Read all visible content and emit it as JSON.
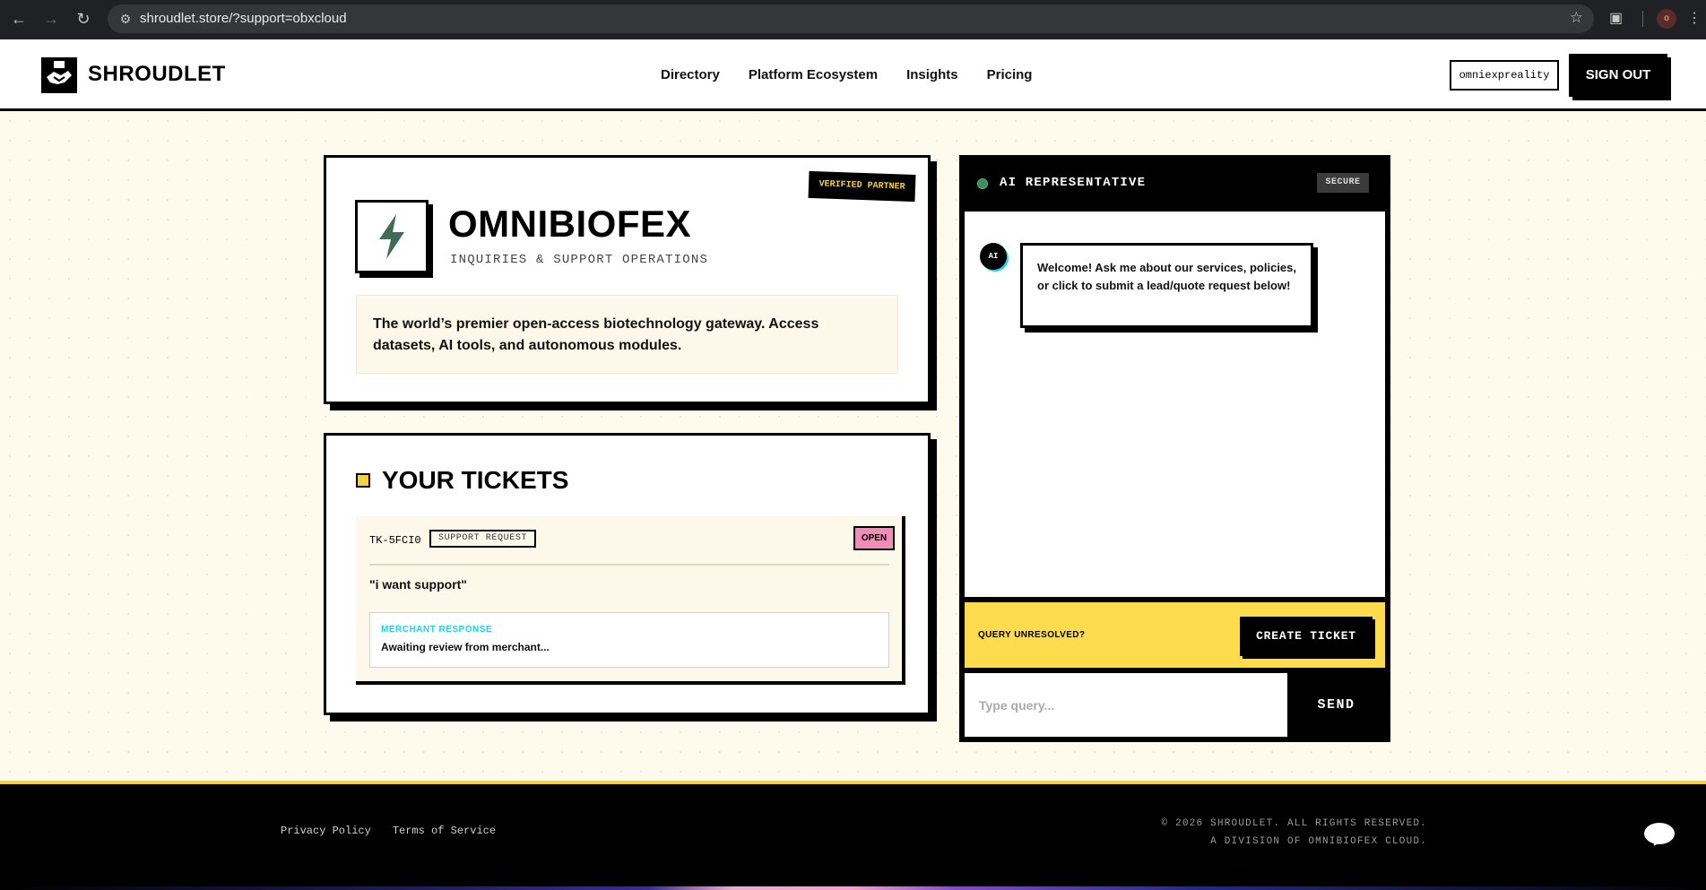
{
  "browser": {
    "url": "shroudlet.store/?support=obxcloud",
    "profile_initial": "o"
  },
  "header": {
    "logo_text": "SHROUDLET",
    "nav": [
      "Directory",
      "Platform Ecosystem",
      "Insights",
      "Pricing"
    ],
    "username": "omniexpreality",
    "signout_label": "SIGN OUT"
  },
  "company": {
    "badge": "VERIFIED PARTNER",
    "name": "OMNIBIOFEX",
    "subtitle": "INQUIRIES & SUPPORT OPERATIONS",
    "description": "The world’s premier open-access biotechnology gateway. Access datasets, AI tools, and autonomous modules.",
    "icon": "lightning-bolt-icon"
  },
  "tickets": {
    "title": "YOUR TICKETS",
    "items": [
      {
        "id": "TK-5FCI0",
        "type": "SUPPORT REQUEST",
        "status": "OPEN",
        "message": "\"i want support\"",
        "response_label": "MERCHANT RESPONSE",
        "response_text": "Awaiting review from merchant..."
      }
    ]
  },
  "chat": {
    "title": "AI REPRESENTATIVE",
    "secure_badge": "SECURE",
    "avatar_label": "AI",
    "welcome_message": "Welcome! Ask me about our services, policies, or click to submit a lead/quote request below!",
    "cta_label": "QUERY UNRESOLVED?",
    "cta_button": "CREATE TICKET",
    "input_placeholder": "Type query...",
    "send_label": "SEND"
  },
  "footer": {
    "links": [
      "Privacy Policy",
      "Terms of Service"
    ],
    "copyright_line1": "© 2026 SHROUDLET. ALL RIGHTS RESERVED.",
    "copyright_line2": "A DIVISION OF OMNIBIOFEX CLOUD."
  },
  "colors": {
    "accent_yellow": "#fcdc4c",
    "status_open_pink": "#f28cb7",
    "response_cyan": "#21d2e6",
    "bolt_green": "#3f6b57",
    "background_cream": "#fffbec"
  }
}
